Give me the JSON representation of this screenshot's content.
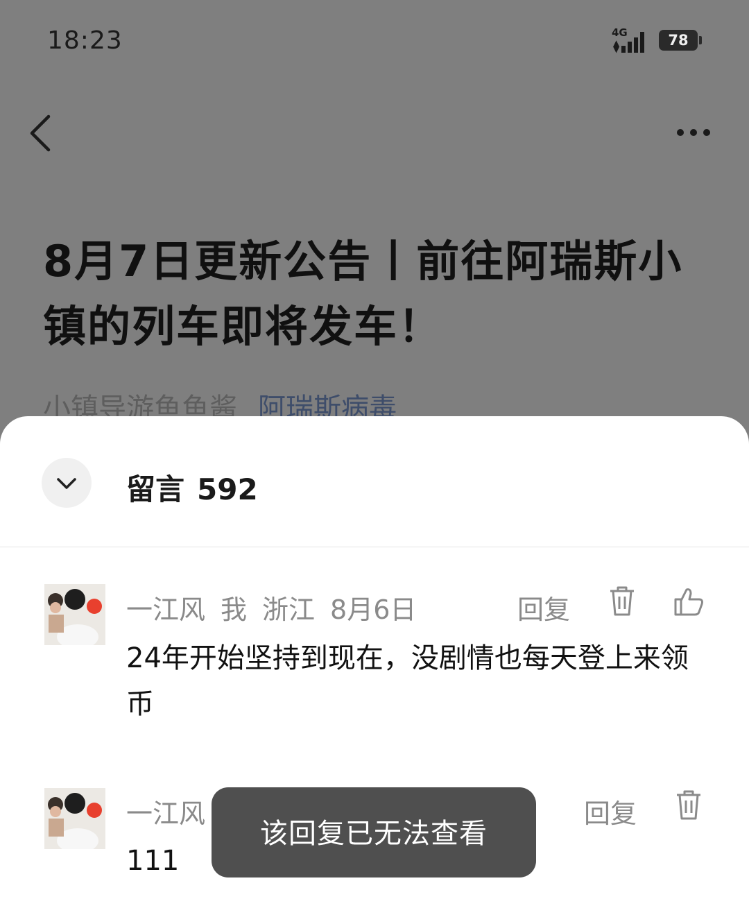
{
  "status": {
    "time": "18:23",
    "network": "4G",
    "battery": "78"
  },
  "nav": {
    "back_icon": "back-chevron-icon",
    "more_icon": "more-dots-icon"
  },
  "article": {
    "title": "8月7日更新公告丨前往阿瑞斯小镇的列车即将发车！",
    "author": "小镇导游鱼鱼酱",
    "account": "阿瑞斯病毒"
  },
  "comments_panel": {
    "label": "留言",
    "count": "592",
    "comments": [
      {
        "user": "一江风",
        "me_tag": "我",
        "location": "浙江",
        "date": "8月6日",
        "text": "24年开始坚持到现在，没剧情也每天登上来领币",
        "reply_label": "回复"
      },
      {
        "user": "一江风",
        "text": "111",
        "reply_label": "回复"
      }
    ]
  },
  "toast": {
    "message": "该回复已无法查看"
  }
}
